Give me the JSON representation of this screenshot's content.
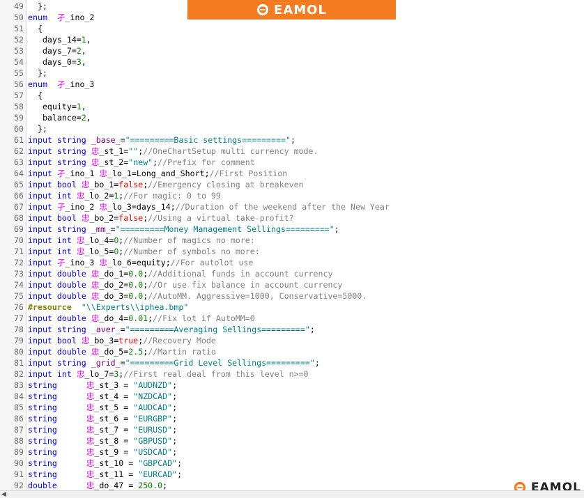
{
  "branding": {
    "logo_text": "EAMOL",
    "colors": {
      "banner_bg": "#f47b1f",
      "logo_mark": "#f47b1f"
    }
  },
  "syntax_colors": {
    "keyword": "#0000ff",
    "glyph": "#ee00ee",
    "comment": "#808080",
    "number": "#008000",
    "string": "#008080",
    "boolean": "#ff0000",
    "preprocessor": "#808000"
  },
  "lines": [
    {
      "n": "49",
      "tokens": [
        [
          "tx",
          "  };"
        ]
      ]
    },
    {
      "n": "50",
      "tokens": [
        [
          "k",
          "enum"
        ],
        [
          "tx",
          "  "
        ],
        [
          "g",
          "孑"
        ],
        [
          "tx",
          "_ino_2"
        ]
      ]
    },
    {
      "n": "51",
      "tokens": [
        [
          "tx",
          "  {"
        ]
      ]
    },
    {
      "n": "52",
      "tokens": [
        [
          "tx",
          "   days_14="
        ],
        [
          "n",
          "1"
        ],
        [
          "tx",
          ","
        ]
      ]
    },
    {
      "n": "53",
      "tokens": [
        [
          "tx",
          "   days_7="
        ],
        [
          "n",
          "2"
        ],
        [
          "tx",
          ","
        ]
      ]
    },
    {
      "n": "54",
      "tokens": [
        [
          "tx",
          "   days_0="
        ],
        [
          "n",
          "3"
        ],
        [
          "tx",
          ","
        ]
      ]
    },
    {
      "n": "55",
      "tokens": [
        [
          "tx",
          "  };"
        ]
      ]
    },
    {
      "n": "56",
      "tokens": [
        [
          "k",
          "enum"
        ],
        [
          "tx",
          "  "
        ],
        [
          "g",
          "孑"
        ],
        [
          "tx",
          "_ino_3"
        ]
      ]
    },
    {
      "n": "57",
      "tokens": [
        [
          "tx",
          "  {"
        ]
      ]
    },
    {
      "n": "58",
      "tokens": [
        [
          "tx",
          "   equity="
        ],
        [
          "n",
          "1"
        ],
        [
          "tx",
          ","
        ]
      ]
    },
    {
      "n": "59",
      "tokens": [
        [
          "tx",
          "   balance="
        ],
        [
          "n",
          "2"
        ],
        [
          "tx",
          ","
        ]
      ]
    },
    {
      "n": "60",
      "tokens": [
        [
          "tx",
          "  };"
        ]
      ]
    },
    {
      "n": "61",
      "tokens": [
        [
          "k",
          "input string "
        ],
        [
          "v",
          "_base_"
        ],
        [
          "tx",
          "="
        ],
        [
          "s",
          "\"=========Basic settings=========\""
        ],
        [
          "tx",
          ";"
        ]
      ]
    },
    {
      "n": "62",
      "tokens": [
        [
          "k",
          "input string "
        ],
        [
          "g",
          "忠"
        ],
        [
          "tx",
          "_st_1="
        ],
        [
          "s",
          "\"\""
        ],
        [
          "tx",
          ";"
        ],
        [
          "c",
          "//OneChartSetup multi currency mode."
        ]
      ]
    },
    {
      "n": "63",
      "tokens": [
        [
          "k",
          "input string "
        ],
        [
          "g",
          "忠"
        ],
        [
          "tx",
          "_st_2="
        ],
        [
          "s",
          "\"new\""
        ],
        [
          "tx",
          ";"
        ],
        [
          "c",
          "//Prefix for comment"
        ]
      ]
    },
    {
      "n": "64",
      "tokens": [
        [
          "k",
          "input "
        ],
        [
          "g",
          "孑"
        ],
        [
          "tx",
          "_ino_1 "
        ],
        [
          "g",
          "忠"
        ],
        [
          "tx",
          "_lo_1=Long_and_Short;"
        ],
        [
          "c",
          "//First Position"
        ]
      ]
    },
    {
      "n": "65",
      "tokens": [
        [
          "k",
          "input bool "
        ],
        [
          "g",
          "忠"
        ],
        [
          "tx",
          "_bo_1="
        ],
        [
          "b",
          "false"
        ],
        [
          "tx",
          ";"
        ],
        [
          "c",
          "//Emergency closing at breakeven"
        ]
      ]
    },
    {
      "n": "66",
      "tokens": [
        [
          "k",
          "input int "
        ],
        [
          "g",
          "忠"
        ],
        [
          "tx",
          "_lo_2="
        ],
        [
          "n",
          "1"
        ],
        [
          "tx",
          ";"
        ],
        [
          "c",
          "//For magic: 0 to 99"
        ]
      ]
    },
    {
      "n": "67",
      "tokens": [
        [
          "k",
          "input "
        ],
        [
          "g",
          "孑"
        ],
        [
          "tx",
          "_ino_2 "
        ],
        [
          "g",
          "忠"
        ],
        [
          "tx",
          "_lo_3=days_14;"
        ],
        [
          "c",
          "//Duration of the weekend after the New Year"
        ]
      ]
    },
    {
      "n": "68",
      "tokens": [
        [
          "k",
          "input bool "
        ],
        [
          "g",
          "忠"
        ],
        [
          "tx",
          "_bo_2="
        ],
        [
          "b",
          "false"
        ],
        [
          "tx",
          ";"
        ],
        [
          "c",
          "//Using a virtual take-profit?"
        ]
      ]
    },
    {
      "n": "69",
      "tokens": [
        [
          "k",
          "input string "
        ],
        [
          "v",
          "_mm_"
        ],
        [
          "tx",
          "="
        ],
        [
          "s",
          "\"=========Money Management Sellings=========\""
        ],
        [
          "tx",
          ";"
        ]
      ]
    },
    {
      "n": "70",
      "tokens": [
        [
          "k",
          "input int "
        ],
        [
          "g",
          "忠"
        ],
        [
          "tx",
          "_lo_4="
        ],
        [
          "n",
          "0"
        ],
        [
          "tx",
          ";"
        ],
        [
          "c",
          "//Number of magics no more:"
        ]
      ]
    },
    {
      "n": "71",
      "tokens": [
        [
          "k",
          "input int "
        ],
        [
          "g",
          "忠"
        ],
        [
          "tx",
          "_lo_5="
        ],
        [
          "n",
          "0"
        ],
        [
          "tx",
          ";"
        ],
        [
          "c",
          "//Number of symbols no more:"
        ]
      ]
    },
    {
      "n": "72",
      "tokens": [
        [
          "k",
          "input "
        ],
        [
          "g",
          "孑"
        ],
        [
          "tx",
          "_ino_3 "
        ],
        [
          "g",
          "忠"
        ],
        [
          "tx",
          "_lo_6=equity;"
        ],
        [
          "c",
          "//For autolot use"
        ]
      ]
    },
    {
      "n": "73",
      "tokens": [
        [
          "k",
          "input double "
        ],
        [
          "g",
          "忠"
        ],
        [
          "tx",
          "_do_1="
        ],
        [
          "n",
          "0.0"
        ],
        [
          "tx",
          ";"
        ],
        [
          "c",
          "//Additional funds in account currency"
        ]
      ]
    },
    {
      "n": "74",
      "tokens": [
        [
          "k",
          "input double "
        ],
        [
          "g",
          "忠"
        ],
        [
          "tx",
          "_do_2="
        ],
        [
          "n",
          "0.0"
        ],
        [
          "tx",
          ";"
        ],
        [
          "c",
          "//Or use fix balance in account currency"
        ]
      ]
    },
    {
      "n": "75",
      "tokens": [
        [
          "k",
          "input double "
        ],
        [
          "g",
          "忠"
        ],
        [
          "tx",
          "_do_3="
        ],
        [
          "n",
          "0.0"
        ],
        [
          "tx",
          ";"
        ],
        [
          "c",
          "//AutoMM. Aggressive=1000, Conservative=5000."
        ]
      ]
    },
    {
      "n": "76",
      "tokens": [
        [
          "p",
          "#resource"
        ],
        [
          "tx",
          "  "
        ],
        [
          "s",
          "\"\\\\Experts\\\\iphea.bmp\""
        ]
      ]
    },
    {
      "n": "77",
      "tokens": [
        [
          "k",
          "input double "
        ],
        [
          "g",
          "忠"
        ],
        [
          "tx",
          "_do_4="
        ],
        [
          "n",
          "0.01"
        ],
        [
          "tx",
          ";"
        ],
        [
          "c",
          "//Fix lot if AutoMM=0"
        ]
      ]
    },
    {
      "n": "78",
      "tokens": [
        [
          "k",
          "input string "
        ],
        [
          "v",
          "_aver_"
        ],
        [
          "tx",
          "="
        ],
        [
          "s",
          "\"=========Averaging Sellings=========\""
        ],
        [
          "tx",
          ";"
        ]
      ]
    },
    {
      "n": "79",
      "tokens": [
        [
          "k",
          "input bool "
        ],
        [
          "g",
          "忠"
        ],
        [
          "tx",
          "_bo_3="
        ],
        [
          "b",
          "true"
        ],
        [
          "tx",
          ";"
        ],
        [
          "c",
          "//Recovery Mode"
        ]
      ]
    },
    {
      "n": "80",
      "tokens": [
        [
          "k",
          "input double "
        ],
        [
          "g",
          "忠"
        ],
        [
          "tx",
          "_do_5="
        ],
        [
          "n",
          "2.5"
        ],
        [
          "tx",
          ";"
        ],
        [
          "c",
          "//Martin ratio"
        ]
      ]
    },
    {
      "n": "81",
      "tokens": [
        [
          "k",
          "input string "
        ],
        [
          "v",
          "_grid_"
        ],
        [
          "tx",
          "="
        ],
        [
          "s",
          "\"=========Grid Level Sellings=========\""
        ],
        [
          "tx",
          ";"
        ]
      ]
    },
    {
      "n": "82",
      "tokens": [
        [
          "k",
          "input int "
        ],
        [
          "g",
          "忠"
        ],
        [
          "tx",
          "_lo_7="
        ],
        [
          "n",
          "3"
        ],
        [
          "tx",
          ";"
        ],
        [
          "c",
          "//First real deal from this level n>=0"
        ]
      ]
    },
    {
      "n": "83",
      "tokens": [
        [
          "k",
          "string"
        ],
        [
          "tx",
          "      "
        ],
        [
          "g",
          "忠"
        ],
        [
          "tx",
          "_st_3 = "
        ],
        [
          "s",
          "\"AUDNZD\""
        ],
        [
          "tx",
          ";"
        ]
      ]
    },
    {
      "n": "84",
      "tokens": [
        [
          "k",
          "string"
        ],
        [
          "tx",
          "      "
        ],
        [
          "g",
          "忠"
        ],
        [
          "tx",
          "_st_4 = "
        ],
        [
          "s",
          "\"NZDCAD\""
        ],
        [
          "tx",
          ";"
        ]
      ]
    },
    {
      "n": "85",
      "tokens": [
        [
          "k",
          "string"
        ],
        [
          "tx",
          "      "
        ],
        [
          "g",
          "忠"
        ],
        [
          "tx",
          "_st_5 = "
        ],
        [
          "s",
          "\"AUDCAD\""
        ],
        [
          "tx",
          ";"
        ]
      ]
    },
    {
      "n": "86",
      "tokens": [
        [
          "k",
          "string"
        ],
        [
          "tx",
          "      "
        ],
        [
          "g",
          "忠"
        ],
        [
          "tx",
          "_st_6 = "
        ],
        [
          "s",
          "\"EURGBP\""
        ],
        [
          "tx",
          ";"
        ]
      ]
    },
    {
      "n": "87",
      "tokens": [
        [
          "k",
          "string"
        ],
        [
          "tx",
          "      "
        ],
        [
          "g",
          "忠"
        ],
        [
          "tx",
          "_st_7 = "
        ],
        [
          "s",
          "\"EURUSD\""
        ],
        [
          "tx",
          ";"
        ]
      ]
    },
    {
      "n": "88",
      "tokens": [
        [
          "k",
          "string"
        ],
        [
          "tx",
          "      "
        ],
        [
          "g",
          "忠"
        ],
        [
          "tx",
          "_st_8 = "
        ],
        [
          "s",
          "\"GBPUSD\""
        ],
        [
          "tx",
          ";"
        ]
      ]
    },
    {
      "n": "89",
      "tokens": [
        [
          "k",
          "string"
        ],
        [
          "tx",
          "      "
        ],
        [
          "g",
          "忠"
        ],
        [
          "tx",
          "_st_9 = "
        ],
        [
          "s",
          "\"USDCAD\""
        ],
        [
          "tx",
          ";"
        ]
      ]
    },
    {
      "n": "90",
      "tokens": [
        [
          "k",
          "string"
        ],
        [
          "tx",
          "      "
        ],
        [
          "g",
          "忠"
        ],
        [
          "tx",
          "_st_10 = "
        ],
        [
          "s",
          "\"GBPCAD\""
        ],
        [
          "tx",
          ";"
        ]
      ]
    },
    {
      "n": "91",
      "tokens": [
        [
          "k",
          "string"
        ],
        [
          "tx",
          "      "
        ],
        [
          "g",
          "忠"
        ],
        [
          "tx",
          "_st_11 = "
        ],
        [
          "s",
          "\"EURCAD\""
        ],
        [
          "tx",
          ";"
        ]
      ]
    },
    {
      "n": "92",
      "tokens": [
        [
          "k",
          "double"
        ],
        [
          "tx",
          "      "
        ],
        [
          "g",
          "忠"
        ],
        [
          "tx",
          "_do_47 = "
        ],
        [
          "n",
          "250.0"
        ],
        [
          "tx",
          ";"
        ]
      ]
    }
  ]
}
